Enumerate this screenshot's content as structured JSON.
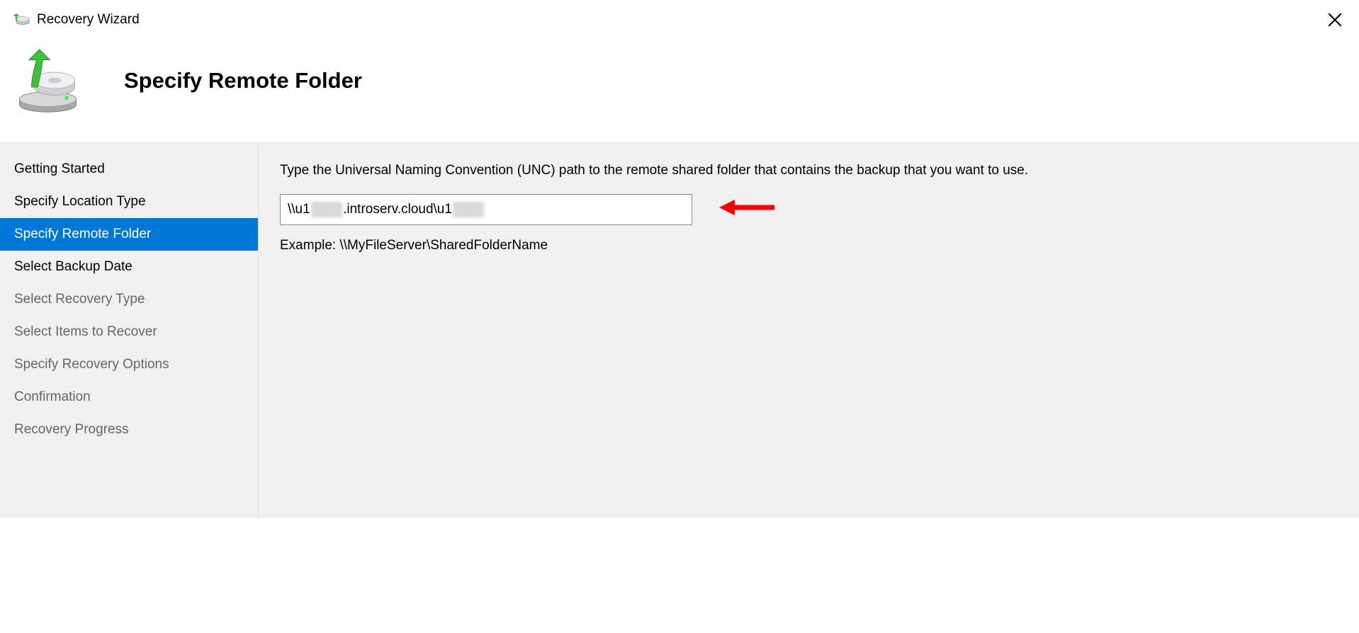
{
  "window": {
    "title": "Recovery Wizard"
  },
  "header": {
    "title": "Specify Remote Folder"
  },
  "sidebar": {
    "items": [
      {
        "label": "Getting Started",
        "state": "done"
      },
      {
        "label": "Specify Location Type",
        "state": "done"
      },
      {
        "label": "Specify Remote Folder",
        "state": "selected"
      },
      {
        "label": "Select Backup Date",
        "state": "next"
      },
      {
        "label": "Select Recovery Type",
        "state": "disabled"
      },
      {
        "label": "Select Items to Recover",
        "state": "disabled"
      },
      {
        "label": "Specify Recovery Options",
        "state": "disabled"
      },
      {
        "label": "Confirmation",
        "state": "disabled"
      },
      {
        "label": "Recovery Progress",
        "state": "disabled"
      }
    ]
  },
  "main": {
    "instruction": "Type the Universal Naming Convention (UNC) path to the remote shared folder that contains the backup that you want to use.",
    "path": {
      "prefix": "\\\\u1",
      "redacted1": "███",
      "mid": ".introserv.cloud\\u1",
      "redacted2": "███"
    },
    "example": "Example: \\\\MyFileServer\\SharedFolderName"
  }
}
